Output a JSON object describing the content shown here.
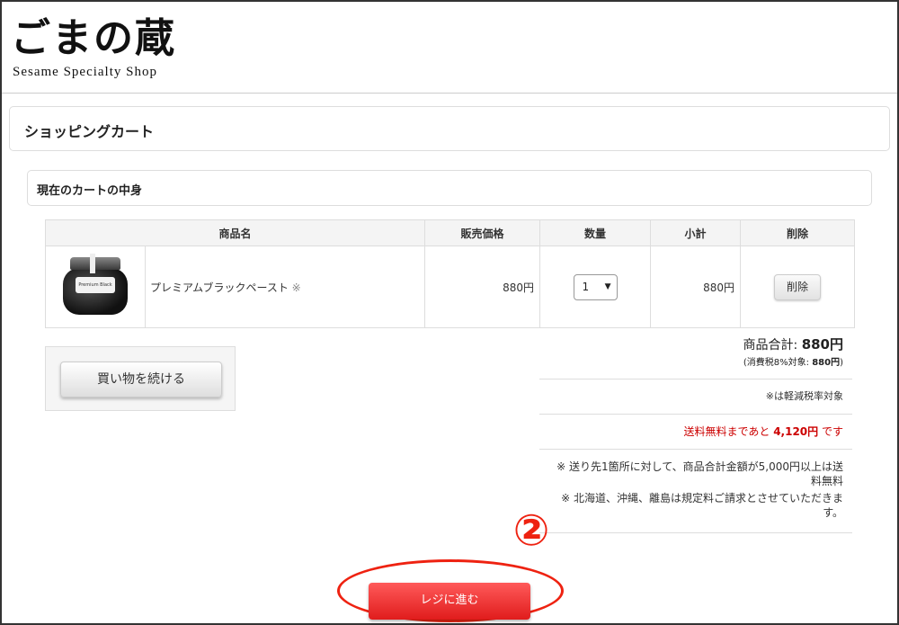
{
  "header": {
    "logo_jp": "ごまの蔵",
    "logo_en": "Sesame Specialty Shop"
  },
  "page_title": "ショッピングカート",
  "section_title": "現在のカートの中身",
  "table": {
    "headers": [
      "商品名",
      "販売価格",
      "数量",
      "小計",
      "削除"
    ],
    "rows": [
      {
        "image_label": "Premium Black Paste",
        "name": "プレミアムブラックペースト",
        "reduced_mark": "※",
        "price": "880円",
        "quantity": "1",
        "subtotal": "880円",
        "delete_label": "削除"
      }
    ]
  },
  "continue_shopping_label": "買い物を続ける",
  "summary": {
    "total_label": "商品合計:",
    "total_value": "880円",
    "tax_prefix": "(消費税8%対象:",
    "tax_value": "880円",
    "tax_suffix": ")",
    "reduced_note": "※は軽減税率対象",
    "free_prefix": "送料無料まであと",
    "free_amount": "4,120円",
    "free_suffix": "です",
    "shipping_note_1": "※ 送り先1箇所に対して、商品合計金額が5,000円以上は送料無料",
    "shipping_note_2": "※ 北海道、沖縄、離島は規定料ご請求とさせていただきます。"
  },
  "annotation_marker": "②",
  "checkout_label": "レジに進む",
  "colors": {
    "checkout_bg": "#e82b2b",
    "free_shipping_text": "#cc0000",
    "annotation": "#ee2211"
  }
}
